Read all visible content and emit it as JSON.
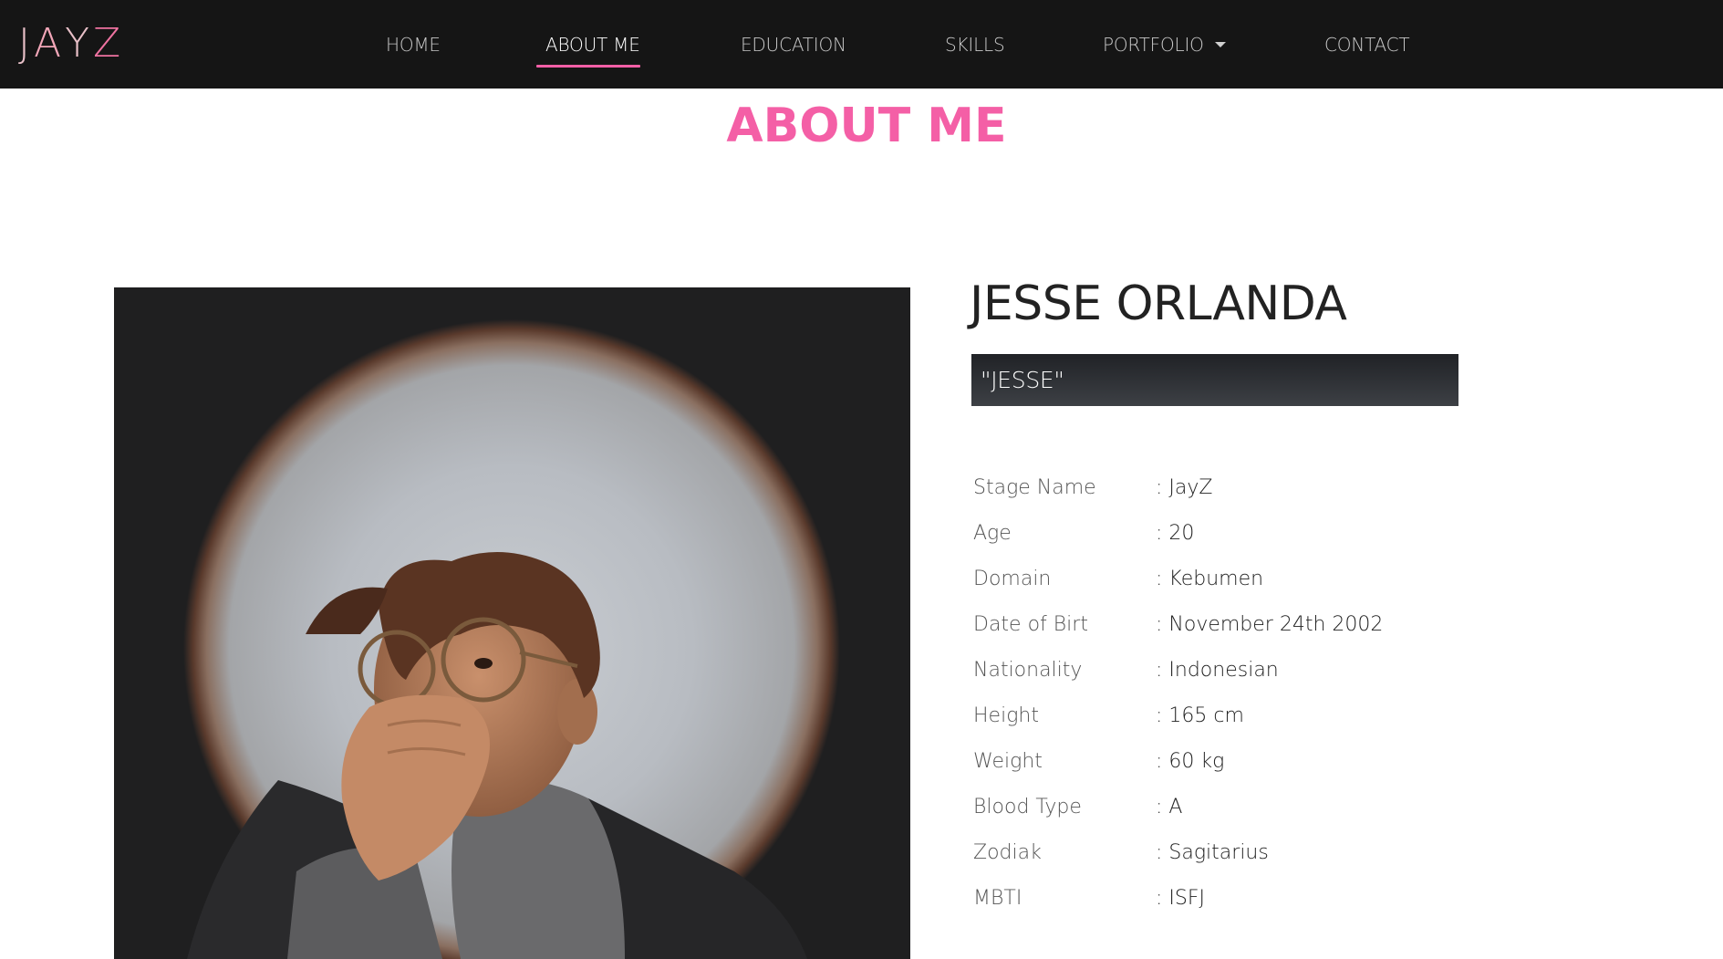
{
  "brand": {
    "logo_text": "JAYZ",
    "colors": [
      "#e8c0c8",
      "#f2a6b8",
      "#e8c0c8",
      "#ee72a0"
    ]
  },
  "nav": {
    "items": [
      {
        "label": "HOME"
      },
      {
        "label": "ABOUT ME",
        "active": true
      },
      {
        "label": "EDUCATION"
      },
      {
        "label": "SKILLS"
      },
      {
        "label": "PORTFOLIO",
        "has_dropdown": true
      },
      {
        "label": "CONTACT"
      }
    ],
    "accent_color": "#f45fa6",
    "background_color": "#151515"
  },
  "page": {
    "title": "ABOUT ME",
    "title_color": "#f45fa6"
  },
  "profile": {
    "full_name": "JESSE ORLANDA",
    "nickname": "\"JESSE\"",
    "details": [
      {
        "label": "Stage Name",
        "value": ": JayZ"
      },
      {
        "label": "Age",
        "value": ": 20"
      },
      {
        "label": "Domain",
        "value": ": Kebumen"
      },
      {
        "label": "Date of Birt",
        "value": ": November 24th 2002"
      },
      {
        "label": "Nationality",
        "value": ": Indonesian"
      },
      {
        "label": "Height",
        "value": ": 165 cm"
      },
      {
        "label": "Weight",
        "value": ": 60 kg"
      },
      {
        "label": "Blood Type",
        "value": ": A"
      },
      {
        "label": "Zodiak",
        "value": ": Sagitarius"
      },
      {
        "label": "MBTI",
        "value": ": ISFJ"
      }
    ]
  }
}
